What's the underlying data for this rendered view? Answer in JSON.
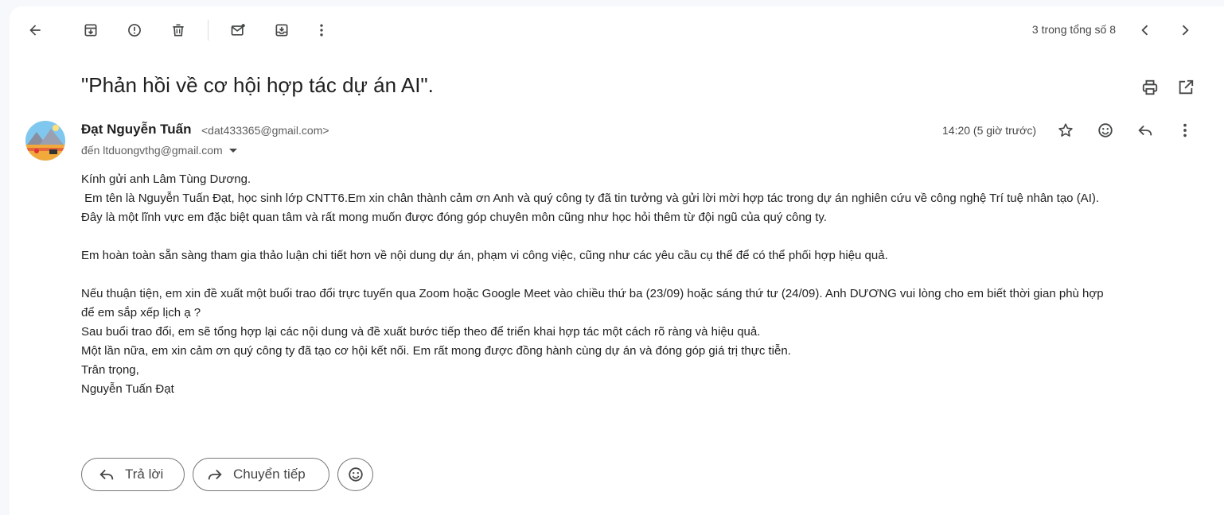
{
  "toolbar": {
    "back": "arrow-left-icon",
    "archive": "archive-icon",
    "spam": "report-spam-icon",
    "delete": "trash-icon",
    "mark_unread": "mark-unread-icon",
    "move": "move-to-icon",
    "more": "more-vert-icon",
    "pager": "3 trong tổng số 8"
  },
  "message": {
    "subject": "\"Phản hồi về cơ hội hợp tác dự án AI\".",
    "sender_name": "Đạt Nguyễn Tuấn",
    "sender_email": "<dat433365@gmail.com>",
    "to_line": "đến ltduongvthg@gmail.com",
    "time": "14:20 (5 giờ trước)",
    "body": {
      "greeting": "Kính gửi anh Lâm Tùng Dương.",
      "p1_line1": " Em tên là Nguyễn Tuấn Đạt, học sinh lớp CNTT6.Em xin chân thành cảm ơn Anh và quý công ty đã tin tưởng và gửi lời mời hợp tác trong dự án nghiên cứu về công nghệ Trí tuệ nhân tạo (AI).",
      "p1_line2": "Đây là một lĩnh vực em đặc biệt quan tâm và rất mong muốn được đóng góp chuyên môn cũng như học hỏi thêm từ đội ngũ của quý công ty.",
      "p2": "Em hoàn toàn sẵn sàng tham gia thảo luận chi tiết hơn về nội dung dự án, phạm vi công việc, cũng như các yêu cầu cụ thể để có thể phối hợp hiệu quả.",
      "p3_line1": "Nếu thuận tiện, em xin đề xuất một buổi trao đổi trực tuyến qua Zoom hoặc Google Meet vào chiều thứ ba (23/09) hoặc sáng thứ tư (24/09). Anh DƯƠNG vui lòng cho em biết thời gian phù hợp",
      "p3_line2": "để em sắp xếp lịch ạ ?",
      "p4": "Sau buổi trao đổi, em sẽ tổng hợp lại các nội dung và đề xuất bước tiếp theo để triển khai hợp tác một cách rõ ràng và hiệu quả.",
      "p5": "Một lần nữa, em xin cảm ơn quý công ty đã tạo cơ hội kết nối. Em rất mong được đồng hành cùng dự án và đóng góp giá trị thực tiễn.",
      "closing": "Trân trọng,",
      "signature": "Nguyễn Tuấn Đạt"
    }
  },
  "actions": {
    "reply_label": "Trả lời",
    "forward_label": "Chuyển tiếp"
  },
  "colors": {
    "background": "#f6f8fc",
    "card": "#ffffff",
    "icon": "#444746"
  }
}
